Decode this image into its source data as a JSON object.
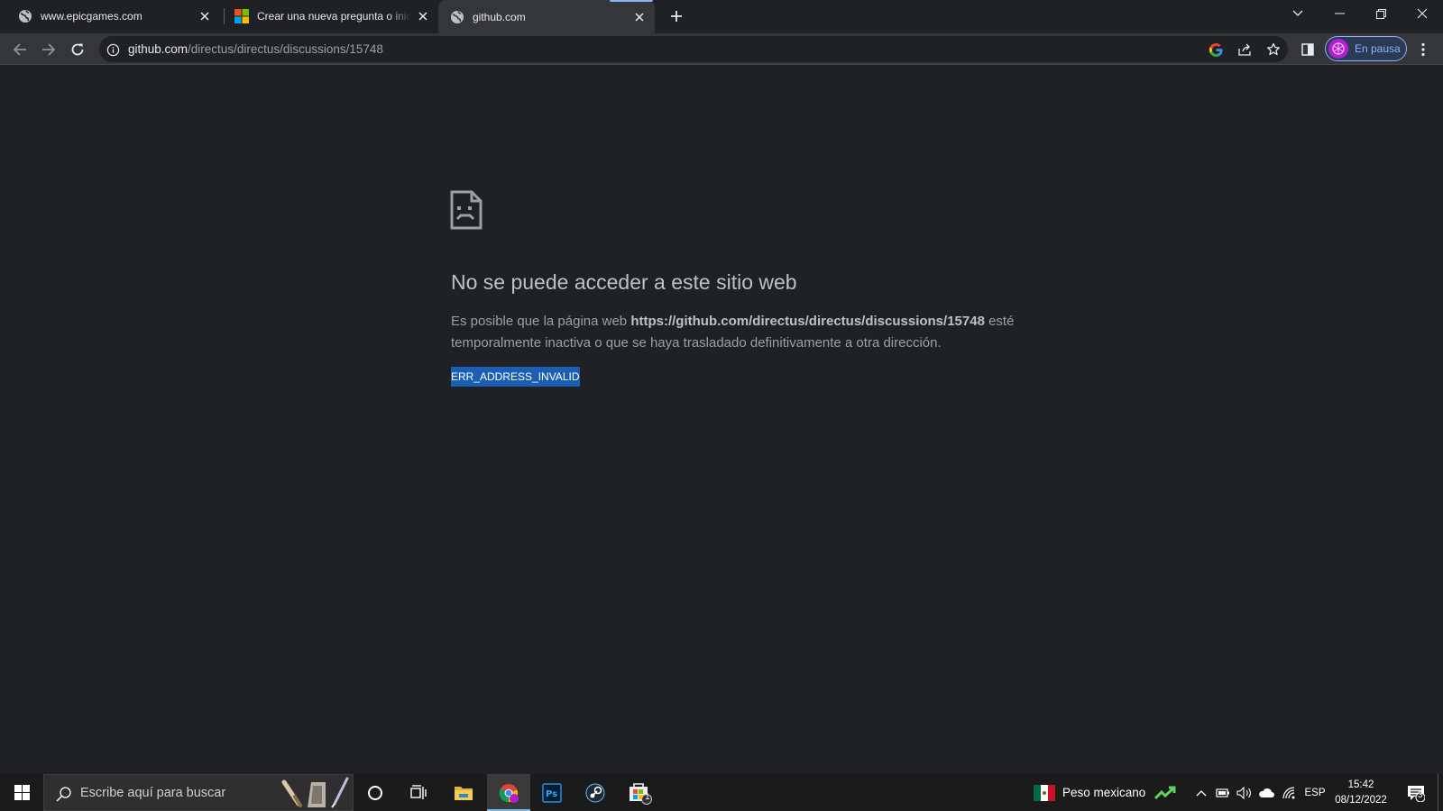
{
  "browser": {
    "tabs": [
      {
        "title": "www.epicgames.com",
        "icon": "globe-icon",
        "active": false
      },
      {
        "title": "Crear una nueva pregunta o iniciar una discusión",
        "icon": "microsoft-logo-icon",
        "active": false
      },
      {
        "title": "github.com",
        "icon": "globe-icon",
        "active": true
      }
    ],
    "url_host": "github.com",
    "url_path": "/directus/directus/discussions/15748",
    "profile_label": "En pausa",
    "accent_color": "#8ab4f8"
  },
  "error_page": {
    "title": "No se puede acceder a este sitio web",
    "desc_prefix": "Es posible que la página web ",
    "desc_url": "https://github.com/directus/directus/discussions/15748",
    "desc_suffix": " esté temporalmente inactiva o que se haya trasladado definitivamente a otra dirección.",
    "error_code": "ERR_ADDRESS_INVALID"
  },
  "taskbar": {
    "search_placeholder": "Escribe aquí para buscar",
    "weather_label": "Peso mexicano",
    "language": "ESP",
    "time": "15:42",
    "date": "08/12/2022",
    "notification_count": "3",
    "store_badge": "1"
  }
}
